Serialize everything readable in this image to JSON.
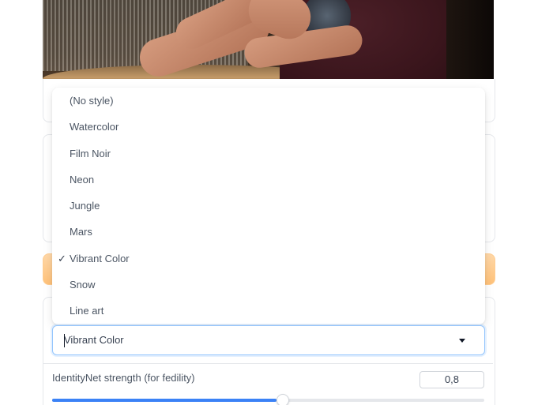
{
  "style_dropdown": {
    "options": [
      "(No style)",
      "Watercolor",
      "Film Noir",
      "Neon",
      "Jungle",
      "Mars",
      "Vibrant Color",
      "Snow",
      "Line art"
    ],
    "selected": "Vibrant Color",
    "check_mark": "✓"
  },
  "identitynet": {
    "label": "IdentityNet strength (for fedility)",
    "value": "0,8",
    "level_fraction": 0.52
  },
  "colors": {
    "accent_blue": "#3b82f6",
    "orange_button": "#ffc27a",
    "focus_border": "#93c5fd"
  },
  "icons": {
    "select_arrow": "caret-down-icon",
    "selected_marker": "check-icon"
  }
}
